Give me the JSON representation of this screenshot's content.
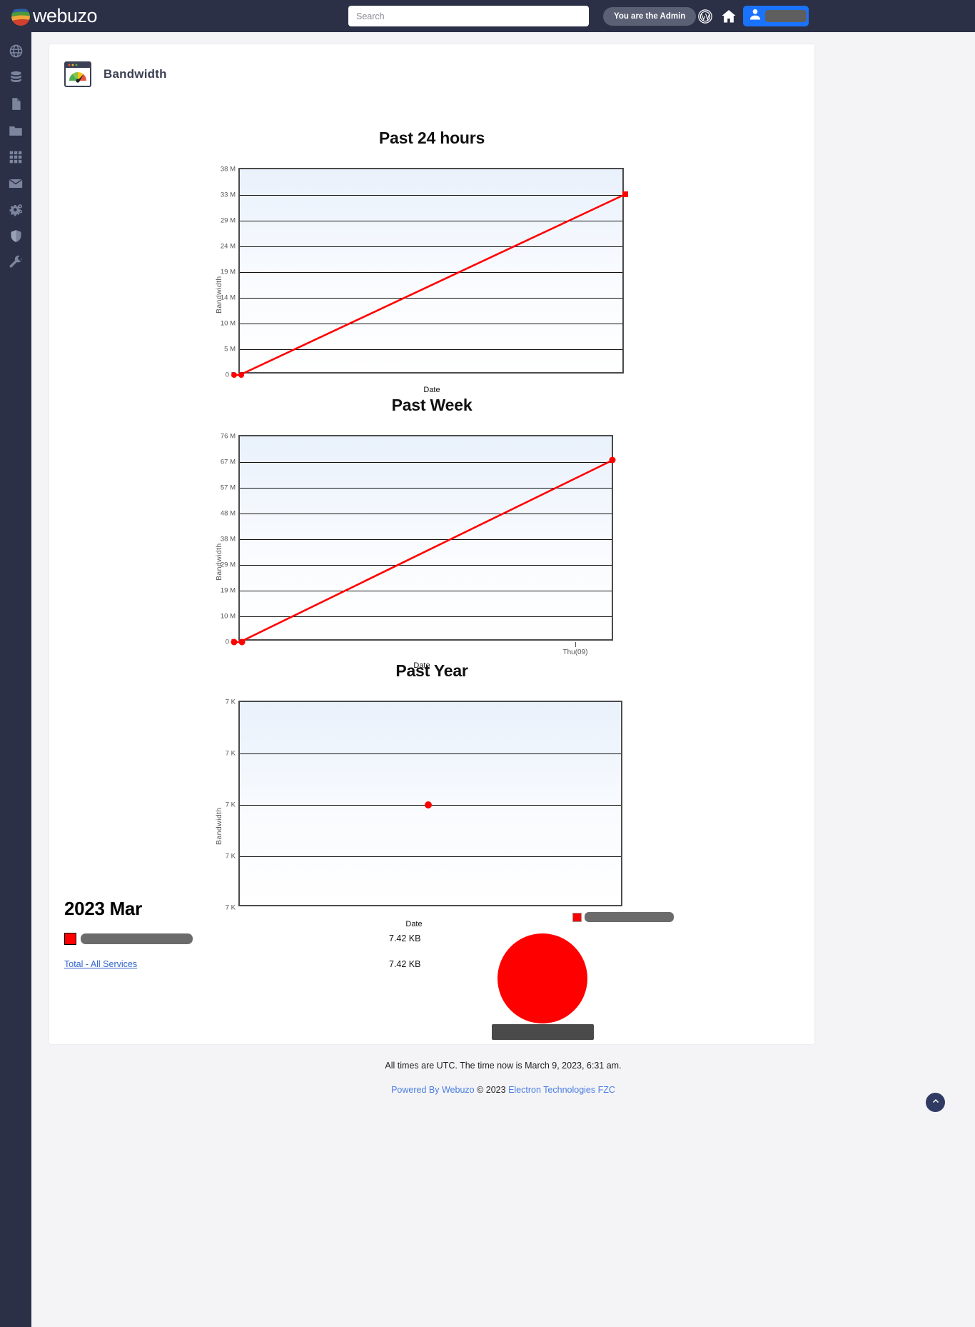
{
  "header": {
    "brand": "webuzo",
    "brand_logo_icon": "webuzo-globe-logo",
    "search_placeholder": "Search",
    "search_value": "",
    "admin_label": "You are the Admin",
    "wordpress_icon": "wordpress-icon",
    "home_icon": "home-icon",
    "user_icon": "user-icon",
    "user_label": ""
  },
  "sidebar": {
    "items": [
      {
        "name": "globe",
        "icon": "globe-icon"
      },
      {
        "name": "database",
        "icon": "database-icon"
      },
      {
        "name": "file",
        "icon": "file-icon"
      },
      {
        "name": "folder",
        "icon": "folder-icon"
      },
      {
        "name": "apps",
        "icon": "grid-apps-icon"
      },
      {
        "name": "mail",
        "icon": "envelope-icon"
      },
      {
        "name": "settings",
        "icon": "gears-icon"
      },
      {
        "name": "security",
        "icon": "shield-icon"
      },
      {
        "name": "tools",
        "icon": "wrench-icon"
      }
    ]
  },
  "page": {
    "icon": "bandwidth-gauge-icon",
    "title": "Bandwidth"
  },
  "chart_data": [
    {
      "type": "line",
      "title": "Past 24 hours",
      "xlabel": "Date",
      "ylabel": "Bandwidth",
      "yticks": [
        "0 B",
        "5 M",
        "10 M",
        "14 M",
        "19 M",
        "24 M",
        "29 M",
        "33 M",
        "38 M"
      ],
      "ylim": [
        0,
        38
      ],
      "xticks": [],
      "grid": true,
      "series": [
        {
          "name": "Bandwidth",
          "color": "#ff0000",
          "points": [
            [
              0,
              0
            ],
            [
              0.015,
              0.05
            ],
            [
              1,
              33.4
            ]
          ]
        }
      ]
    },
    {
      "type": "line",
      "title": "Past Week",
      "xlabel": "Date",
      "ylabel": "Bandwidth",
      "yticks": [
        "0 B",
        "10 M",
        "19 M",
        "29 M",
        "38 M",
        "48 M",
        "57 M",
        "67 M",
        "76 M"
      ],
      "ylim": [
        0,
        76
      ],
      "xticks": [
        "Thu(09)"
      ],
      "xtick_positions": [
        0.895
      ],
      "grid": true,
      "series": [
        {
          "name": "Bandwidth",
          "color": "#ff0000",
          "points": [
            [
              0,
              0
            ],
            [
              0.017,
              0.3
            ],
            [
              1,
              67.6
            ]
          ]
        }
      ]
    },
    {
      "type": "scatter",
      "title": "Past Year",
      "xlabel": "Date",
      "ylabel": "Bandwidth",
      "yticks": [
        "7 K",
        "7 K",
        "7 K",
        "7 K",
        "7 K"
      ],
      "ylim": [
        0,
        4
      ],
      "xticks": [],
      "grid": true,
      "series": [
        {
          "name": "Bandwidth",
          "color": "#ff0000",
          "points": [
            [
              0.49,
              2.0
            ]
          ]
        }
      ]
    }
  ],
  "summary": {
    "title": "2023 Mar",
    "rows": [
      {
        "label": "",
        "redacted": true,
        "swatch_color": "#ff0000",
        "value": "7.42 KB"
      }
    ],
    "total_label": "Total - All Services",
    "total_value": "7.42 KB"
  },
  "pie": {
    "legend_label": "",
    "legend_color": "#ff0000",
    "caption": ""
  },
  "footer": {
    "time_note": "All times are UTC. The time now is March 9, 2023, 6:31 am.",
    "powered_by": "Powered By Webuzo",
    "copyright": "© 2023",
    "company": "Electron Technologies FZC",
    "scroll_top_icon": "chevron-up-icon"
  }
}
